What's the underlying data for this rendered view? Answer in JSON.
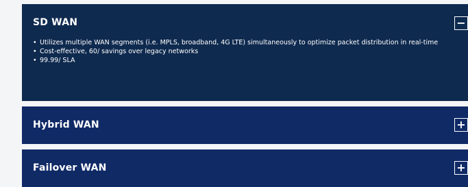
{
  "accordion": {
    "items": [
      {
        "title": "SD WAN",
        "toggle": "−",
        "expanded": true,
        "bullets": [
          "Utilizes multiple WAN segments (i.e. MPLS, broadband, 4G LTE) simultaneously to optimize packet distribution in real-time",
          "Cost-effective, 60/ savings over legacy networks",
          "99.99/ SLA"
        ]
      },
      {
        "title": "Hybrid WAN",
        "toggle": "+",
        "expanded": false
      },
      {
        "title": "Failover WAN",
        "toggle": "+",
        "expanded": false
      }
    ]
  },
  "colors": {
    "expanded_panel_bg": "#0f2a4f",
    "collapsed_panel_bg": "#102a66",
    "text": "#ffffff",
    "page_bg": "#f4f5f7"
  },
  "icons": {
    "expanded": "minus-icon",
    "collapsed": "plus-icon"
  }
}
